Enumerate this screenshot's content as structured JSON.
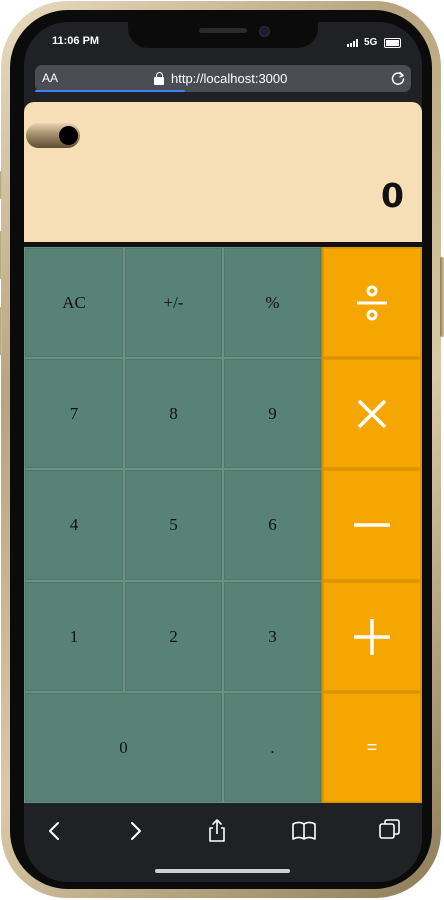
{
  "status_bar": {
    "time": "11:06 PM",
    "network": "5G"
  },
  "browser": {
    "text_size_label": "AA",
    "url": "http://localhost:3000"
  },
  "calculator": {
    "display_value": "0",
    "keys": {
      "clear": "AC",
      "sign": "+/-",
      "percent": "%",
      "seven": "7",
      "eight": "8",
      "nine": "9",
      "four": "4",
      "five": "5",
      "six": "6",
      "one": "1",
      "two": "2",
      "three": "3",
      "zero": "0",
      "decimal": ".",
      "equals": "="
    },
    "accent_color": "#f5a600",
    "key_color": "#588275",
    "display_color": "#f6dfb7"
  },
  "toolbar": {
    "icons": [
      "back-icon",
      "forward-icon",
      "share-icon",
      "bookmarks-icon",
      "tabs-icon"
    ]
  }
}
